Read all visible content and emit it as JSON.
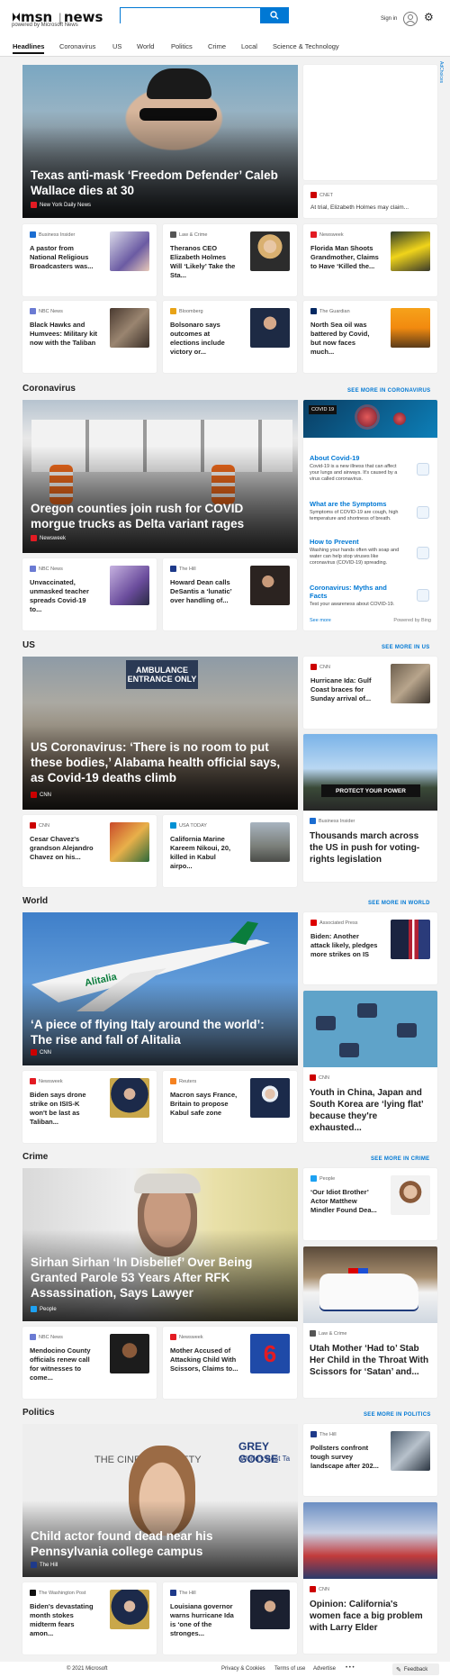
{
  "header": {
    "brand_a": "msn",
    "brand_b": "news",
    "tagline": "powered by Microsoft News",
    "search_placeholder": "",
    "signin": "Sign in"
  },
  "nav": [
    "Headlines",
    "Coronavirus",
    "US",
    "World",
    "Politics",
    "Crime",
    "Local",
    "Science & Technology"
  ],
  "sidebar_ad": "AdChoices",
  "headlines": {
    "hero": {
      "source": "New York Daily News",
      "title": "Texas anti-mask ‘Freedom Defender’ Caleb Wallace dies at 30"
    },
    "ad_card": {
      "source": "CNET",
      "title": "At trial, Elizabeth Holmes may claim..."
    },
    "row1": [
      {
        "source": "Business Insider",
        "title": "A pastor from National Religious Broadcasters was..."
      },
      {
        "source": "Law & Crime",
        "title": "Theranos CEO Elizabeth Holmes Will ‘Likely’ Take the Sta..."
      },
      {
        "source": "Newsweek",
        "title": "Florida Man Shoots Grandmother, Claims to Have ‘Killed the..."
      }
    ],
    "row2": [
      {
        "source": "NBC News",
        "title": "Black Hawks and Humvees: Military kit now with the Taliban"
      },
      {
        "source": "Bloomberg",
        "title": "Bolsonaro says outcomes at elections include victory or..."
      },
      {
        "source": "The Guardian",
        "title": "North Sea oil was battered by Covid, but now faces much..."
      }
    ]
  },
  "coronavirus": {
    "title": "Coronavirus",
    "see_more": "SEE MORE IN CORONAVIRUS",
    "hero": {
      "source": "Newsweek",
      "title": "Oregon counties join rush for COVID morgue trucks as Delta variant rages"
    },
    "row": [
      {
        "source": "NBC News",
        "title": "Unvaccinated, unmasked teacher spreads Covid-19 to..."
      },
      {
        "source": "The Hill",
        "title": "Howard Dean calls DeSantis a ‘lunatic’ over handling of..."
      }
    ],
    "info": {
      "badge": "COVID 19",
      "items": [
        {
          "h": "About Covid-19",
          "d": "Covid-19 is a new illness that can affect your lungs and airways. It's caused by a virus called coronavirus."
        },
        {
          "h": "What are the Symptoms",
          "d": "Symptoms of COVID-19 are cough, high temperature and shortness of breath."
        },
        {
          "h": "How to Prevent",
          "d": "Washing your hands often with soap and water can help stop viruses like coronavirus (COVID-19) spreading."
        },
        {
          "h": "Coronavirus: Myths and Facts",
          "d": "Test your awareness about COVID-19."
        }
      ],
      "see_more": "See more",
      "powered": "Powered by Bing"
    }
  },
  "us": {
    "title": "US",
    "see_more": "SEE MORE IN US",
    "hero": {
      "source": "CNN",
      "title": "US Coronavirus: ‘There is no room to put these bodies,’ Alabama health official says, as Covid-19 deaths climb"
    },
    "side": {
      "source": "CNN",
      "title": "Hurricane Ida: Gulf Coast braces for Sunday arrival of..."
    },
    "row": [
      {
        "source": "CNN",
        "title": "Cesar Chavez's grandson Alejandro Chavez on his..."
      },
      {
        "source": "USA TODAY",
        "title": "California Marine Kareem Nikoui, 20, killed in Kabul airpo..."
      }
    ],
    "media": {
      "source": "Business Insider",
      "title": "Thousands march across the US in push for voting-rights legislation"
    },
    "protest_sign": "PROTECT YOUR POWER"
  },
  "world": {
    "title": "World",
    "see_more": "SEE MORE IN WORLD",
    "hero": {
      "source": "CNN",
      "title": "‘A piece of flying Italy around the world’: The rise and fall of Alitalia"
    },
    "side": {
      "source": "Associated Press",
      "title": "Biden: Another attack likely, pledges more strikes on IS"
    },
    "row": [
      {
        "source": "Newsweek",
        "title": "Biden says drone strike on ISIS-K won't be last as Taliban..."
      },
      {
        "source": "Reuters",
        "title": "Macron says France, Britain to propose Kabul safe zone"
      }
    ],
    "media": {
      "source": "CNN",
      "title": "Youth in China, Japan and South Korea are ‘lying flat’ because they're exhausted..."
    },
    "livery": "Alitalia"
  },
  "crime": {
    "title": "Crime",
    "see_more": "SEE MORE IN CRIME",
    "hero": {
      "source": "People",
      "title": "Sirhan Sirhan ‘In Disbelief’ Over Being Granted Parole 53 Years After RFK Assassination, Says Lawyer"
    },
    "side": {
      "source": "People",
      "title": "‘Our Idiot Brother’ Actor Matthew Mindler Found Dea..."
    },
    "row": [
      {
        "source": "NBC News",
        "title": "Mendocino County officials renew call for witnesses to come..."
      },
      {
        "source": "Newsweek",
        "title": "Mother Accused of Attacking Child With Scissors, Claims to..."
      }
    ],
    "media": {
      "source": "Law & Crime",
      "title": "Utah Mother ‘Had to’ Stab Her Child in the Throat With Scissors for ‘Satan’ and..."
    },
    "thumb_sign": "6"
  },
  "politics": {
    "title": "Politics",
    "see_more": "SEE MORE IN POLITICS",
    "hero": {
      "source": "The Hill",
      "title": "Child actor found dead near his Pennsylvania college campus"
    },
    "side": {
      "source": "The Hill",
      "title": "Pollsters confront tough survey landscape after 202..."
    },
    "row": [
      {
        "source": "The Washington Post",
        "title": "Biden's devastating month stokes midterm fears amon..."
      },
      {
        "source": "The Hill",
        "title": "Louisiana governor warns hurricane Ida is ‘one of the stronges..."
      }
    ],
    "media": {
      "source": "CNN",
      "title": "Opinion: California's women face a big problem with Larry Elder"
    },
    "backdrop_a": "THE CINEMA SOCIETY",
    "backdrop_b": "GREY GOOSE",
    "backdrop_c": "World's Best Ta"
  },
  "footer": {
    "copyright": "© 2021 Microsoft",
    "privacy": "Privacy & Cookies",
    "terms": "Terms of use",
    "advertise": "Advertise",
    "more": "• • •",
    "feedback": "Feedback"
  },
  "colors": {
    "accent": "#0078d4",
    "cnn": "#cc0000",
    "newsweek": "#e31b23",
    "hill": "#1e3a8a",
    "nbc": "#6b7bd3",
    "people": "#1da1f2"
  }
}
